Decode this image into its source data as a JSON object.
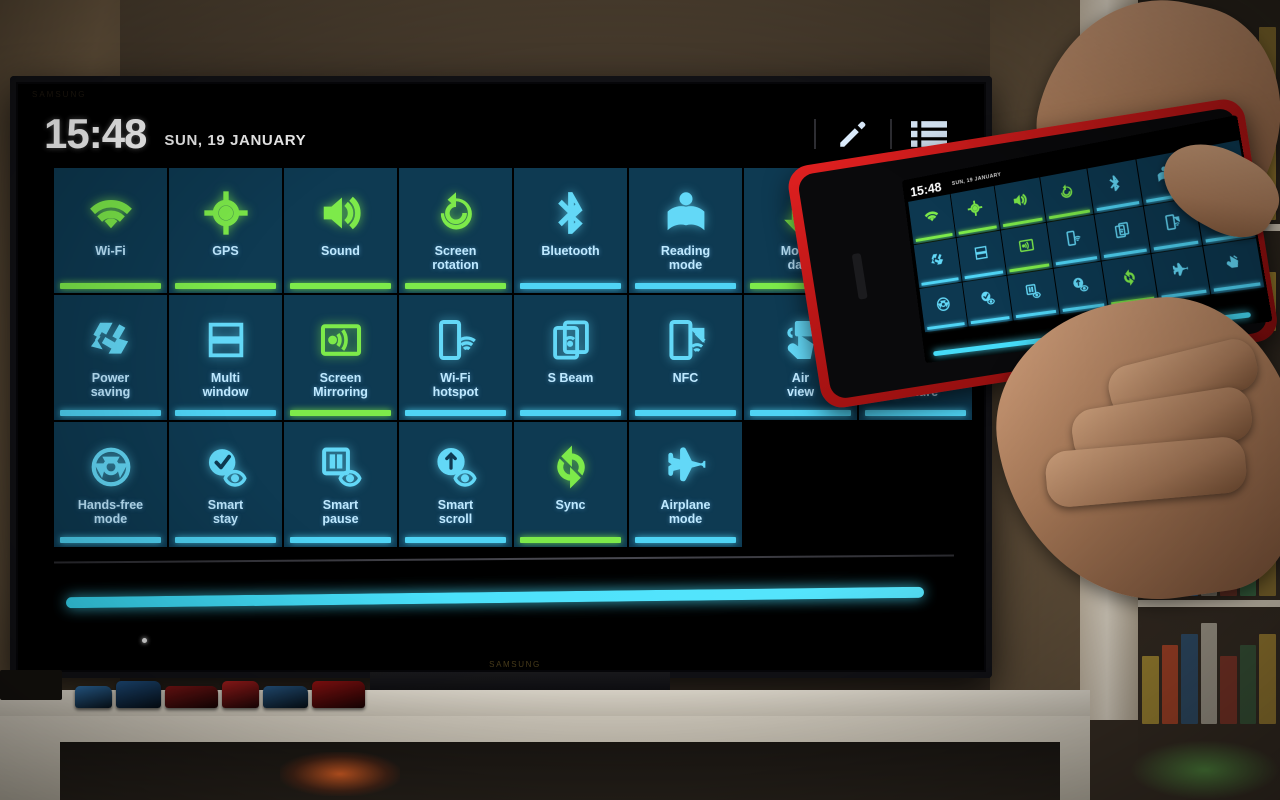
{
  "scene": {
    "description": "Samsung TV displaying an Android quick settings panel mirrored from a phone held in hands",
    "tv_brand_logo": "SAMSUNG",
    "screen_watermark": "SAMSUNG"
  },
  "status_bar": {
    "time": "15:48",
    "date": "SUN, 19 JANUARY",
    "edit_icon": "pencil-icon",
    "list_icon": "list-icon"
  },
  "quick_settings": {
    "tiles": [
      {
        "label": "Wi-Fi",
        "icon": "wifi-icon",
        "state": "on"
      },
      {
        "label": "GPS",
        "icon": "gps-icon",
        "state": "on"
      },
      {
        "label": "Sound",
        "icon": "sound-icon",
        "state": "on"
      },
      {
        "label": "Screen\nrotation",
        "icon": "screen-rotation-icon",
        "state": "on"
      },
      {
        "label": "Bluetooth",
        "icon": "bluetooth-icon",
        "state": "off"
      },
      {
        "label": "Reading\nmode",
        "icon": "reading-mode-icon",
        "state": "off"
      },
      {
        "label": "Mobile\ndata",
        "icon": "mobile-data-icon",
        "state": "on"
      },
      {
        "label": "Power\nsaving",
        "icon": "power-saving-icon",
        "state": "off"
      },
      {
        "label": "Multi\nwindow",
        "icon": "multi-window-icon",
        "state": "off"
      },
      {
        "label": "Screen\nMirroring",
        "icon": "screen-mirroring-icon",
        "state": "on"
      },
      {
        "label": "Wi-Fi\nhotspot",
        "icon": "wifi-hotspot-icon",
        "state": "off"
      },
      {
        "label": "S Beam",
        "icon": "s-beam-icon",
        "state": "off"
      },
      {
        "label": "NFC",
        "icon": "nfc-icon",
        "state": "off"
      },
      {
        "label": "Air\nview",
        "icon": "air-view-icon",
        "state": "off"
      },
      {
        "label": "Hands-free\nmode",
        "icon": "hands-free-icon",
        "state": "off"
      },
      {
        "label": "Smart\nstay",
        "icon": "smart-stay-icon",
        "state": "off"
      },
      {
        "label": "Smart\npause",
        "icon": "smart-pause-icon",
        "state": "off"
      },
      {
        "label": "Smart\nscroll",
        "icon": "smart-scroll-icon",
        "state": "off"
      },
      {
        "label": "Sync",
        "icon": "sync-icon",
        "state": "on"
      },
      {
        "label": "Airplane\nmode",
        "icon": "airplane-mode-icon",
        "state": "off"
      }
    ],
    "occluded_tile": {
      "label": "Air\ngesture",
      "icon": "air-gesture-icon",
      "state": "off"
    },
    "brightness_slider": {
      "value_percent": 100,
      "color": "#4fe2fb"
    }
  },
  "colors": {
    "tile_background": "#0e3a52",
    "active_green": "#7dea4a",
    "inactive_cyan": "#4fd4f5",
    "label_text": "#bfe9ff",
    "screen_black": "#000000",
    "phone_case_red": "#c01818"
  },
  "phone": {
    "clock": "15:48",
    "date": "SUN, 19 JANUARY",
    "case_color": "red",
    "mirrors": "same quick settings panel"
  },
  "decor": {
    "toy_cars": [
      "#2f6fa8",
      "#1f4f80",
      "#7a1515",
      "#a01c1c",
      "#25547f",
      "#8c1111"
    ],
    "shelf_books": [
      "#d4b23c",
      "#c04a2a",
      "#2f6ea8",
      "#d9d2c0",
      "#8f3a2c",
      "#3f7a4e",
      "#c9a33a"
    ]
  }
}
